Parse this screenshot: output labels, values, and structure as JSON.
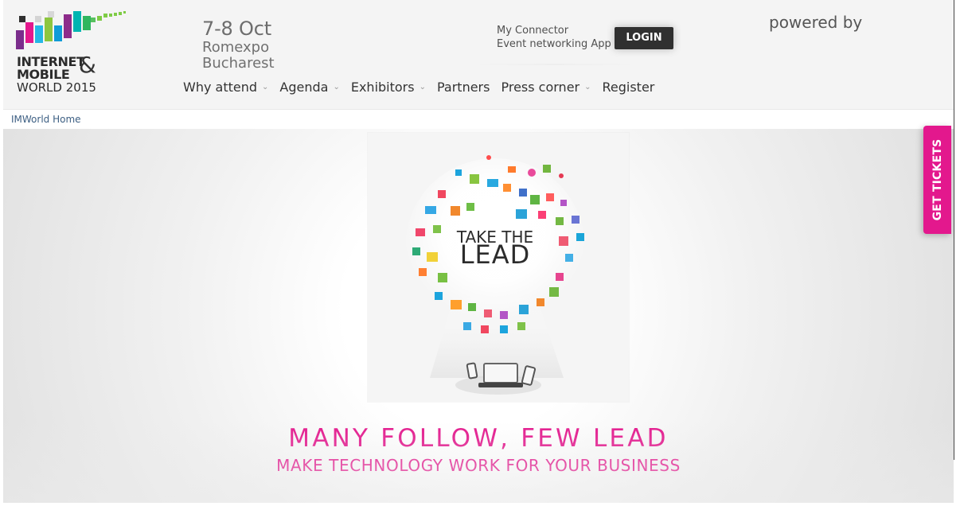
{
  "header": {
    "logo": {
      "line1": "INTERNET",
      "ampersand": "&",
      "line2": "MOBILE",
      "line3": "WORLD 2015"
    },
    "event": {
      "date": "7-8 Oct",
      "venue": "Romexpo",
      "city": "Bucharest"
    },
    "connector": {
      "line1": "My Connector",
      "line2": "Event networking App",
      "login_label": "LOGIN"
    },
    "powered_by": "powered by"
  },
  "navigation": {
    "items": [
      {
        "label": "Why attend",
        "has_caret": true
      },
      {
        "label": "Agenda",
        "has_caret": true
      },
      {
        "label": "Exhibitors",
        "has_caret": true
      },
      {
        "label": "Partners",
        "has_caret": false
      },
      {
        "label": "Press corner",
        "has_caret": true
      },
      {
        "label": "Register",
        "has_caret": false
      }
    ],
    "caret": "⌄"
  },
  "breadcrumb": {
    "label": "IMWorld Home"
  },
  "hero": {
    "illustration_text_line1": "TAKE THE",
    "illustration_text_line2": "LEAD",
    "headline": "MANY FOLLOW, FEW LEAD",
    "subheadline": "MAKE TECHNOLOGY WORK FOR YOUR BUSINESS"
  },
  "side_button": {
    "label": "GET TICKETS"
  },
  "colors": {
    "accent": "#e3188d",
    "nav_text": "#333333",
    "breadcrumb": "#3d5f83"
  },
  "icons": {
    "logo_icon": "pixel-logo-icon",
    "login_icon": "login-button",
    "lightbulb_icon": "lightbulb-icon",
    "device_icon": "device-icon"
  }
}
